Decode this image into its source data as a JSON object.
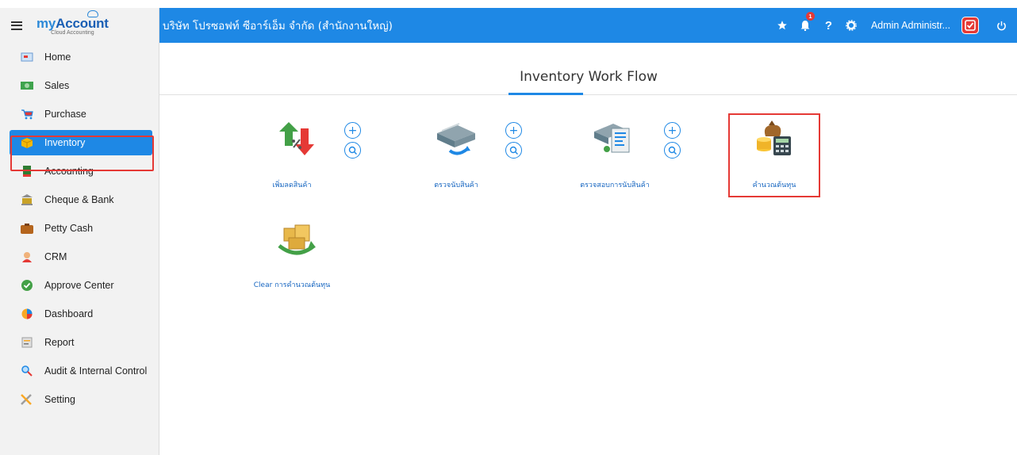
{
  "app": {
    "logo_text_prefix": "my",
    "logo_text_main": "Account",
    "logo_subtitle": "Cloud Accounting"
  },
  "sidebar": {
    "items": [
      {
        "label": "Home",
        "icon": "home-icon"
      },
      {
        "label": "Sales",
        "icon": "sales-icon"
      },
      {
        "label": "Purchase",
        "icon": "cart-icon"
      },
      {
        "label": "Inventory",
        "icon": "box-icon",
        "active": true
      },
      {
        "label": "Accounting",
        "icon": "book-icon"
      },
      {
        "label": "Cheque & Bank",
        "icon": "bank-icon"
      },
      {
        "label": "Petty Cash",
        "icon": "wallet-icon"
      },
      {
        "label": "CRM",
        "icon": "people-icon"
      },
      {
        "label": "Approve Center",
        "icon": "check-circle-icon"
      },
      {
        "label": "Dashboard",
        "icon": "pie-chart-icon"
      },
      {
        "label": "Report",
        "icon": "report-icon"
      },
      {
        "label": "Audit & Internal Control",
        "icon": "magnifier-icon"
      },
      {
        "label": "Setting",
        "icon": "tools-icon"
      }
    ]
  },
  "topbar": {
    "company": "บริษัท โปรซอฟท์ ซีอาร์เอ็ม จำกัด (สำนักงานใหญ่)",
    "notification_count": "1",
    "help_label": "?",
    "user_name": "Admin Administr..."
  },
  "main": {
    "title": "Inventory Work Flow",
    "workflow_items": [
      {
        "label": "เพิ่มลดสินค้า",
        "icon": "adjust-stock-icon",
        "has_actions": true
      },
      {
        "label": "ตรวจนับสินค้า",
        "icon": "stock-count-icon",
        "has_actions": true
      },
      {
        "label": "ตรวจสอบการนับสินค้า",
        "icon": "verify-count-icon",
        "has_actions": true
      },
      {
        "label": "คำนวณต้นทุน",
        "icon": "cost-calc-icon",
        "has_actions": false,
        "highlighted": true
      },
      {
        "label": "Clear การคำนวณต้นทุน",
        "icon": "clear-cost-icon",
        "has_actions": false
      }
    ],
    "add_symbol": "+",
    "accent_color": "#1e88e5",
    "highlight_color": "#e53935"
  }
}
